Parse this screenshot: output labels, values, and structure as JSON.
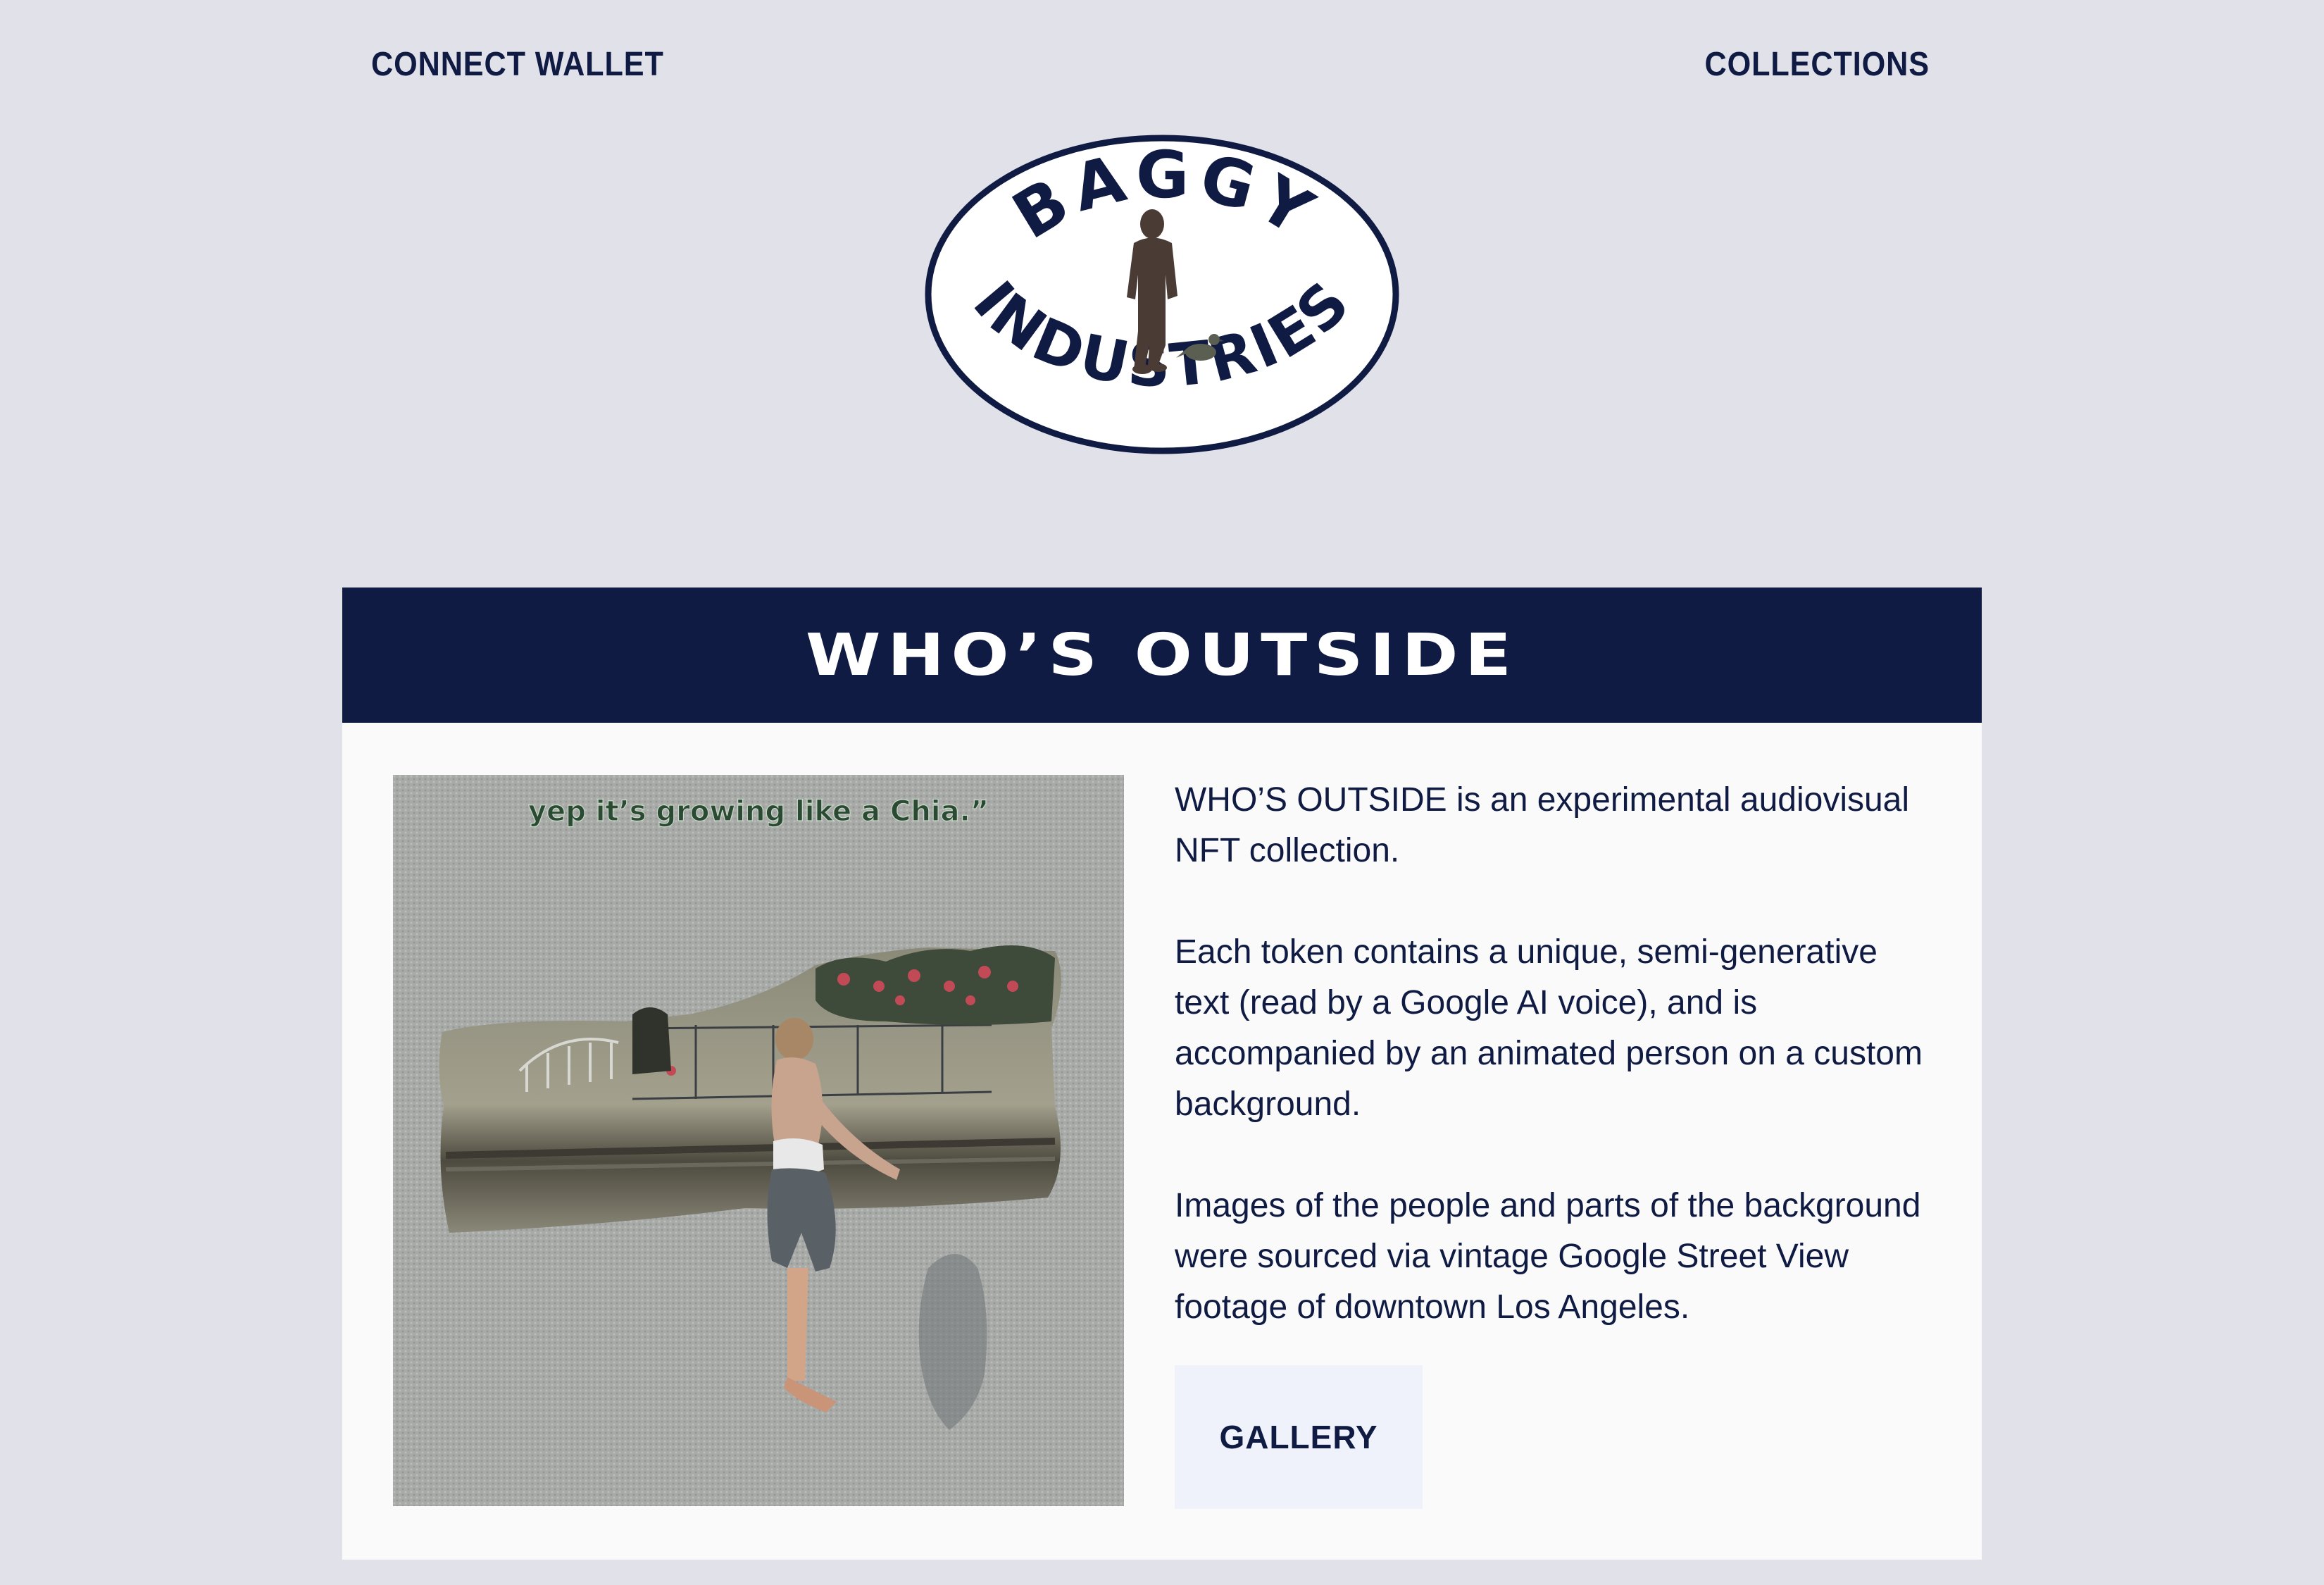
{
  "nav": {
    "connect_wallet": "CONNECT WALLET",
    "collections": "COLLECTIONS"
  },
  "logo": {
    "top_text": "BAGGY",
    "bottom_text": "INDUSTRIES"
  },
  "collection": {
    "title": "WHO’S OUTSIDE",
    "artwork_caption": "yep it’s growing like a Chia.”",
    "description": {
      "name": "WHO’S OUTSIDE",
      "p1_rest": " is an experimental audiovisual NFT collection.",
      "p2": "Each token contains a unique, semi-generative text (read by a Google AI voice), and is accompanied by an animated person on a custom background.",
      "p3": "Images of the people and parts of the background were sourced via vintage Google Street View footage of downtown Los Angeles."
    },
    "gallery_button": "GALLERY"
  },
  "colors": {
    "background": "#e1e1ea",
    "navy": "#101b44",
    "panel": "#fafafa",
    "button_bg": "#eff2fb"
  }
}
